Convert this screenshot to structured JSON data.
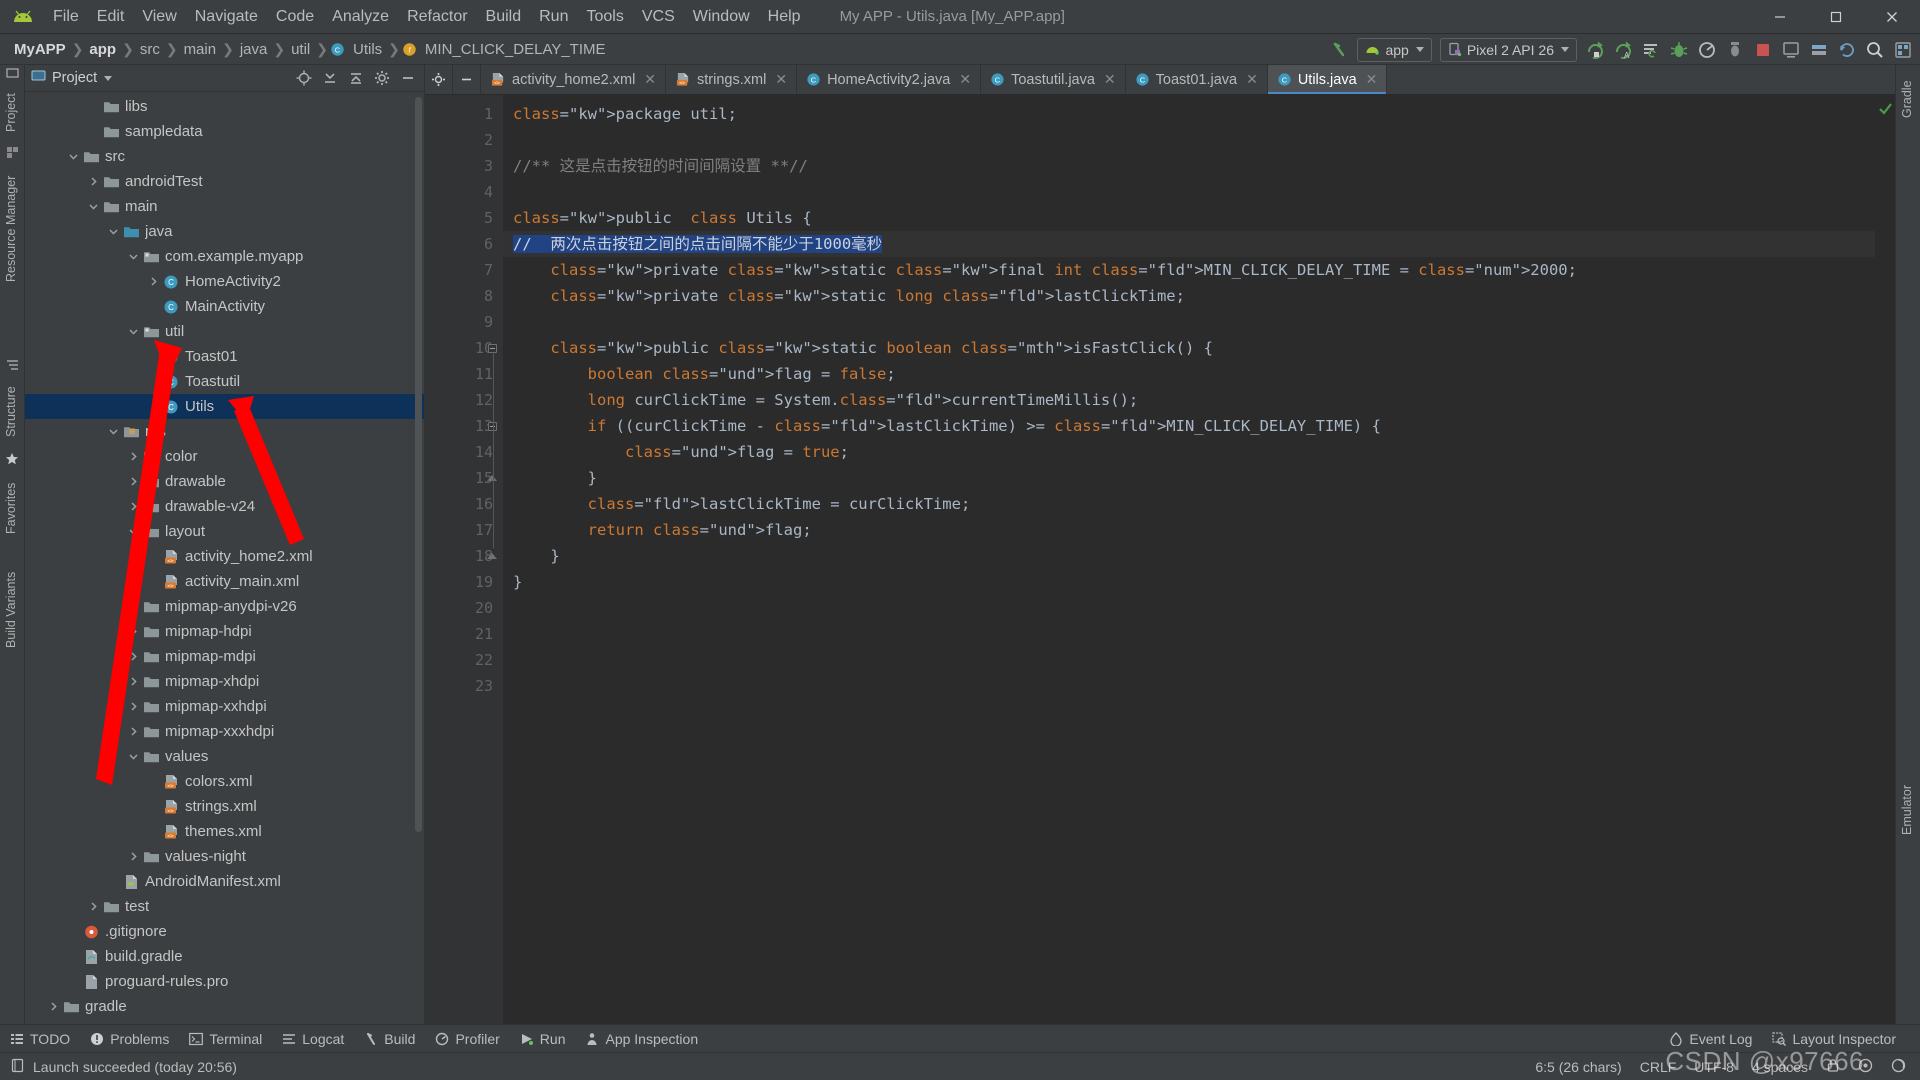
{
  "window": {
    "title": "My APP - Utils.java [My_APP.app]",
    "controls": {
      "minimize": "—",
      "maximize": "❐",
      "close": "✕"
    }
  },
  "menu": {
    "items": [
      "File",
      "Edit",
      "View",
      "Navigate",
      "Code",
      "Analyze",
      "Refactor",
      "Build",
      "Run",
      "Tools",
      "VCS",
      "Window",
      "Help"
    ]
  },
  "breadcrumb": {
    "items": [
      {
        "label": "MyAPP",
        "bold": true,
        "icon": ""
      },
      {
        "label": "app",
        "bold": true,
        "icon": ""
      },
      {
        "label": "src",
        "bold": false,
        "icon": ""
      },
      {
        "label": "main",
        "bold": false,
        "icon": ""
      },
      {
        "label": "java",
        "bold": false,
        "icon": ""
      },
      {
        "label": "util",
        "bold": false,
        "icon": ""
      },
      {
        "label": "Utils",
        "bold": false,
        "icon": "class-icon"
      },
      {
        "label": "MIN_CLICK_DELAY_TIME",
        "bold": false,
        "icon": "field-icon"
      }
    ]
  },
  "toolbar": {
    "module_selector": "app",
    "device_selector": "Pixel 2 API 26",
    "buttons": [
      "make-project-icon",
      "run-icon",
      "run-with-coverage-icon",
      "apply-changes-icon",
      "debug-icon",
      "profile-icon",
      "attach-debugger-icon",
      "stop-icon",
      "avd-manager-icon",
      "sdk-manager-icon",
      "sync-gradle-icon",
      "search-everywhere-icon",
      "project-structure-icon"
    ]
  },
  "left_tool_strip": {
    "tabs": [
      "Project",
      "Resource Manager",
      "Structure",
      "Favorites",
      "Build Variants"
    ]
  },
  "right_tool_strip": {
    "tabs": [
      "Gradle",
      "Emulator"
    ]
  },
  "project_panel": {
    "title": "Project",
    "header_icons": [
      "locate-icon",
      "collapse-selected-icon",
      "collapse-all-icon",
      "settings-icon",
      "hide-icon"
    ],
    "tree": [
      {
        "label": "libs",
        "indent": 3,
        "twisty": "",
        "icon": "folder",
        "selected": false
      },
      {
        "label": "sampledata",
        "indent": 3,
        "twisty": "",
        "icon": "folder",
        "selected": false
      },
      {
        "label": "src",
        "indent": 2,
        "twisty": "down",
        "icon": "folder",
        "selected": false
      },
      {
        "label": "androidTest",
        "indent": 3,
        "twisty": "right",
        "icon": "folder",
        "selected": false
      },
      {
        "label": "main",
        "indent": 3,
        "twisty": "down",
        "icon": "folder",
        "selected": false
      },
      {
        "label": "java",
        "indent": 4,
        "twisty": "down",
        "icon": "folder-blue",
        "selected": false
      },
      {
        "label": "com.example.myapp",
        "indent": 5,
        "twisty": "down",
        "icon": "package",
        "selected": false
      },
      {
        "label": "HomeActivity2",
        "indent": 6,
        "twisty": "right",
        "icon": "class",
        "selected": false
      },
      {
        "label": "MainActivity",
        "indent": 6,
        "twisty": "",
        "icon": "class",
        "selected": false
      },
      {
        "label": "util",
        "indent": 5,
        "twisty": "down",
        "icon": "package",
        "selected": false
      },
      {
        "label": "Toast01",
        "indent": 6,
        "twisty": "",
        "icon": "class",
        "selected": false
      },
      {
        "label": "Toastutil",
        "indent": 6,
        "twisty": "",
        "icon": "class",
        "selected": false
      },
      {
        "label": "Utils",
        "indent": 6,
        "twisty": "",
        "icon": "class",
        "selected": true
      },
      {
        "label": "res",
        "indent": 4,
        "twisty": "down",
        "icon": "res-folder",
        "selected": false
      },
      {
        "label": "color",
        "indent": 5,
        "twisty": "right",
        "icon": "folder",
        "selected": false
      },
      {
        "label": "drawable",
        "indent": 5,
        "twisty": "right",
        "icon": "folder",
        "selected": false
      },
      {
        "label": "drawable-v24",
        "indent": 5,
        "twisty": "right",
        "icon": "folder",
        "selected": false
      },
      {
        "label": "layout",
        "indent": 5,
        "twisty": "down",
        "icon": "folder",
        "selected": false
      },
      {
        "label": "activity_home2.xml",
        "indent": 6,
        "twisty": "",
        "icon": "xml-layout",
        "selected": false
      },
      {
        "label": "activity_main.xml",
        "indent": 6,
        "twisty": "",
        "icon": "xml-layout",
        "selected": false
      },
      {
        "label": "mipmap-anydpi-v26",
        "indent": 5,
        "twisty": "right",
        "icon": "folder",
        "selected": false
      },
      {
        "label": "mipmap-hdpi",
        "indent": 5,
        "twisty": "right",
        "icon": "folder",
        "selected": false
      },
      {
        "label": "mipmap-mdpi",
        "indent": 5,
        "twisty": "right",
        "icon": "folder",
        "selected": false
      },
      {
        "label": "mipmap-xhdpi",
        "indent": 5,
        "twisty": "right",
        "icon": "folder",
        "selected": false
      },
      {
        "label": "mipmap-xxhdpi",
        "indent": 5,
        "twisty": "right",
        "icon": "folder",
        "selected": false
      },
      {
        "label": "mipmap-xxxhdpi",
        "indent": 5,
        "twisty": "right",
        "icon": "folder",
        "selected": false
      },
      {
        "label": "values",
        "indent": 5,
        "twisty": "down",
        "icon": "folder",
        "selected": false
      },
      {
        "label": "colors.xml",
        "indent": 6,
        "twisty": "",
        "icon": "xml-layout",
        "selected": false
      },
      {
        "label": "strings.xml",
        "indent": 6,
        "twisty": "",
        "icon": "xml-layout",
        "selected": false
      },
      {
        "label": "themes.xml",
        "indent": 6,
        "twisty": "",
        "icon": "xml-layout",
        "selected": false
      },
      {
        "label": "values-night",
        "indent": 5,
        "twisty": "right",
        "icon": "folder",
        "selected": false
      },
      {
        "label": "AndroidManifest.xml",
        "indent": 4,
        "twisty": "",
        "icon": "manifest",
        "selected": false
      },
      {
        "label": "test",
        "indent": 3,
        "twisty": "right",
        "icon": "folder",
        "selected": false
      },
      {
        "label": ".gitignore",
        "indent": 2,
        "twisty": "",
        "icon": "gitignore",
        "selected": false
      },
      {
        "label": "build.gradle",
        "indent": 2,
        "twisty": "",
        "icon": "gradle-file",
        "selected": false
      },
      {
        "label": "proguard-rules.pro",
        "indent": 2,
        "twisty": "",
        "icon": "file",
        "selected": false
      },
      {
        "label": "gradle",
        "indent": 1,
        "twisty": "right",
        "icon": "folder",
        "selected": false
      }
    ]
  },
  "editor": {
    "tabs": [
      {
        "label": "activity_home2.xml",
        "icon": "xml-layout-icon",
        "active": false
      },
      {
        "label": "strings.xml",
        "icon": "xml-layout-icon",
        "active": false
      },
      {
        "label": "HomeActivity2.java",
        "icon": "class-icon",
        "active": false
      },
      {
        "label": "Toastutil.java",
        "icon": "class-icon",
        "active": false
      },
      {
        "label": "Toast01.java",
        "icon": "class-icon",
        "active": false
      },
      {
        "label": "Utils.java",
        "icon": "class-icon",
        "active": true
      }
    ],
    "line_numbers": [
      1,
      2,
      3,
      4,
      5,
      6,
      7,
      8,
      9,
      10,
      11,
      12,
      13,
      14,
      15,
      16,
      17,
      18,
      19,
      20,
      21,
      22,
      23
    ],
    "lines": [
      "package util;",
      "",
      "//** 这是点击按钮的时间间隔设置 **//",
      "",
      "public  class Utils {",
      "//  两次点击按钮之间的点击间隔不能少于1000毫秒",
      "    private static final int MIN_CLICK_DELAY_TIME = 2000;",
      "    private static long lastClickTime;",
      "",
      "    public static boolean isFastClick() {",
      "        boolean flag = false;",
      "        long curClickTime = System.currentTimeMillis();",
      "        if ((curClickTime - lastClickTime) >= MIN_CLICK_DELAY_TIME) {",
      "            flag = true;",
      "        }",
      "        lastClickTime = curClickTime;",
      "        return flag;",
      "    }",
      "}",
      "",
      "",
      "",
      ""
    ],
    "inspection_status": "ok-check-icon"
  },
  "tool_windows": {
    "left_items": [
      {
        "label": "TODO",
        "icon": "todo-icon"
      },
      {
        "label": "Problems",
        "icon": "problems-icon"
      },
      {
        "label": "Terminal",
        "icon": "terminal-icon"
      },
      {
        "label": "Logcat",
        "icon": "logcat-icon"
      },
      {
        "label": "Build",
        "icon": "build-icon"
      },
      {
        "label": "Profiler",
        "icon": "profiler-icon"
      },
      {
        "label": "Run",
        "icon": "run-icon"
      },
      {
        "label": "App Inspection",
        "icon": "app-inspection-icon"
      }
    ],
    "right_items": [
      {
        "label": "Event Log",
        "icon": "event-log-icon"
      },
      {
        "label": "Layout Inspector",
        "icon": "layout-inspector-icon"
      }
    ]
  },
  "status_bar": {
    "message": "Launch succeeded (today 20:56)",
    "caret_position": "6:5 (26 chars)",
    "line_separator": "CRLF",
    "encoding": "UTF-8",
    "indent": "4 spaces"
  },
  "watermark": "CSDN @x97666",
  "colors": {
    "accent_blue": "#4a88c7",
    "selection_blue": "#214283",
    "tree_selection": "#0d3158",
    "android_green": "#a4c639",
    "arrow_red": "#ff0000",
    "editor_bg": "#2b2b2b",
    "chrome_bg": "#3c3f41"
  }
}
